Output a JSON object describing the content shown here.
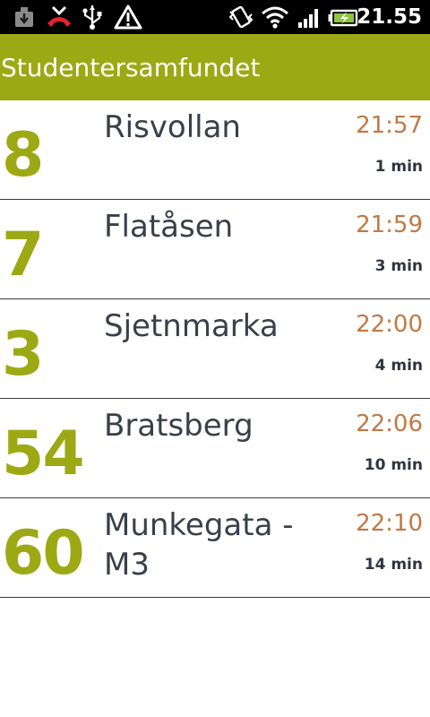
{
  "status_bar": {
    "time": "21.55",
    "icons": [
      "download-icon",
      "missed-call-icon",
      "usb-icon",
      "warning-icon",
      "vibrate-icon",
      "wifi-icon",
      "signal-icon",
      "battery-charging-icon"
    ]
  },
  "header": {
    "title": "Studentersamfundet"
  },
  "departures": [
    {
      "route": "8",
      "destination": "Risvollan",
      "time": "21:57",
      "minutes": "1 min"
    },
    {
      "route": "7",
      "destination": "Flatåsen",
      "time": "21:59",
      "minutes": "3 min"
    },
    {
      "route": "3",
      "destination": "Sjetnmarka",
      "time": "22:00",
      "minutes": "4 min"
    },
    {
      "route": "54",
      "destination": "Bratsberg",
      "time": "22:06",
      "minutes": "10 min"
    },
    {
      "route": "60",
      "destination": "Munkegata - M3",
      "time": "22:10",
      "minutes": "14 min"
    }
  ],
  "colors": {
    "accent": "#9ca914",
    "time": "#c07a45",
    "text": "#3a3f4a"
  }
}
